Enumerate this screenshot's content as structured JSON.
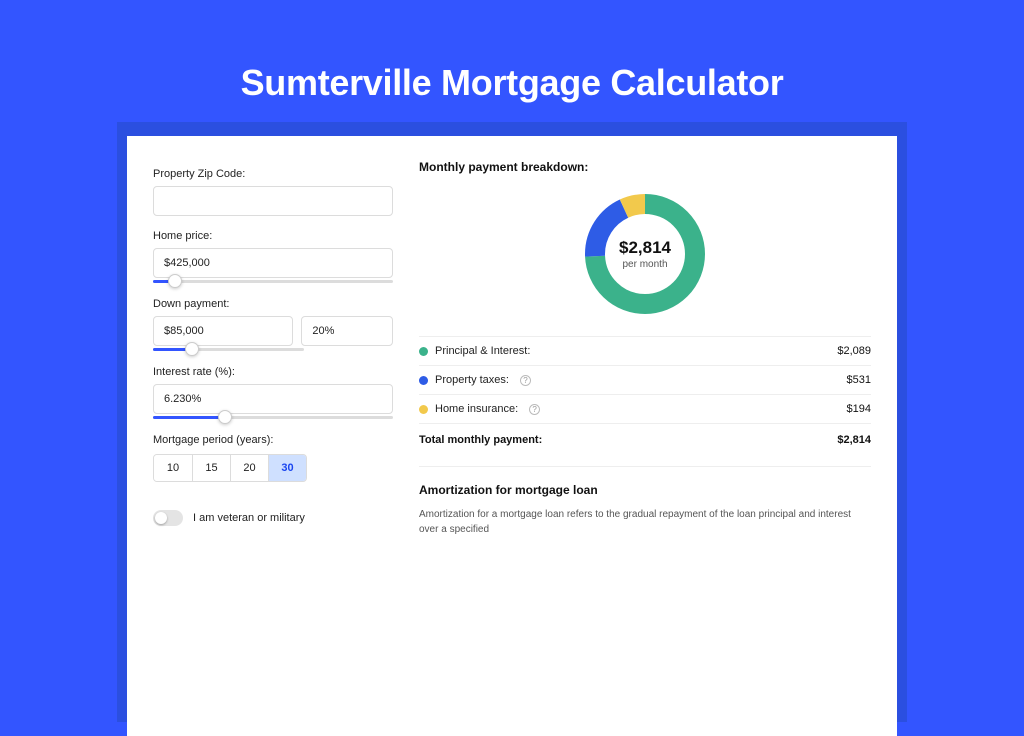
{
  "title": "Sumterville Mortgage Calculator",
  "form": {
    "zip_label": "Property Zip Code:",
    "zip_value": "",
    "price_label": "Home price:",
    "price_value": "$425,000",
    "price_pct": 9,
    "down_label": "Down payment:",
    "down_value": "$85,000",
    "down_pct_value": "20%",
    "down_pct": 20,
    "rate_label": "Interest rate (%):",
    "rate_value": "6.230%",
    "rate_pct": 30,
    "period_label": "Mortgage period (years):",
    "periods": [
      "10",
      "15",
      "20",
      "30"
    ],
    "period_active": 3,
    "vet_label": "I am veteran or military"
  },
  "breakdown": {
    "title": "Monthly payment breakdown:",
    "center_amount": "$2,814",
    "center_sub": "per month",
    "rows": [
      {
        "label": "Principal & Interest:",
        "value": "$2,089",
        "color": "#3bb28b",
        "info": false
      },
      {
        "label": "Property taxes:",
        "value": "$531",
        "color": "#2e5ce6",
        "info": true
      },
      {
        "label": "Home insurance:",
        "value": "$194",
        "color": "#f2c94c",
        "info": true
      }
    ],
    "total_label": "Total monthly payment:",
    "total_value": "$2,814"
  },
  "amort": {
    "title": "Amortization for mortgage loan",
    "body": "Amortization for a mortgage loan refers to the gradual repayment of the loan principal and interest over a specified"
  },
  "chart_data": {
    "type": "pie",
    "title": "Monthly payment breakdown",
    "categories": [
      "Principal & Interest",
      "Property taxes",
      "Home insurance"
    ],
    "values": [
      2089,
      531,
      194
    ],
    "colors": [
      "#3bb28b",
      "#2e5ce6",
      "#f2c94c"
    ],
    "center_label": "$2,814 per month",
    "total": 2814
  }
}
